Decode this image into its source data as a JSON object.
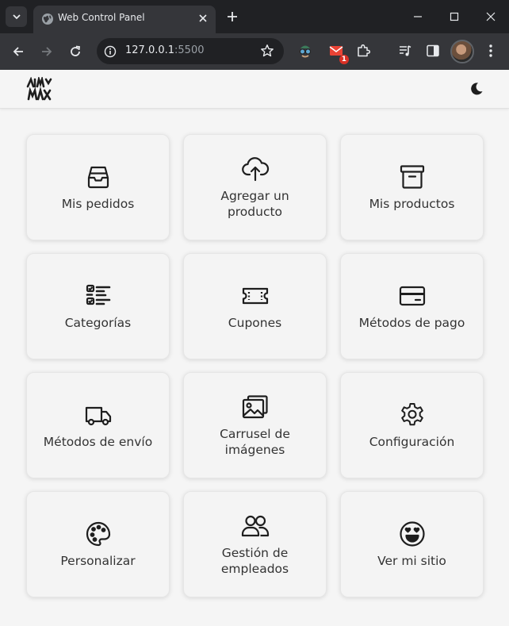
{
  "browser": {
    "tab_title": "Web Control Panel",
    "url_host": "127.0.0.1",
    "url_port": ":5500",
    "extension_badge": "1"
  },
  "colors": {
    "chrome_dark": "#202124",
    "chrome_toolbar": "#35363a",
    "page_bg": "#f5f5f5",
    "card_bg": "#f4f4f4",
    "text": "#333333"
  },
  "header": {
    "logo_icon": "brand-logo",
    "theme_icon": "moon-icon"
  },
  "cards": [
    {
      "label": "Mis pedidos",
      "icon": "inbox-tray-icon"
    },
    {
      "label": "Agregar un producto",
      "icon": "cloud-upload-icon"
    },
    {
      "label": "Mis productos",
      "icon": "archive-box-icon"
    },
    {
      "label": "Categorías",
      "icon": "checklist-icon"
    },
    {
      "label": "Cupones",
      "icon": "ticket-icon"
    },
    {
      "label": "Métodos de pago",
      "icon": "credit-card-icon"
    },
    {
      "label": "Métodos de envío",
      "icon": "truck-icon"
    },
    {
      "label": "Carrusel de imágenes",
      "icon": "photos-icon"
    },
    {
      "label": "Configuración",
      "icon": "gear-icon"
    },
    {
      "label": "Personalizar",
      "icon": "palette-icon"
    },
    {
      "label": "Gestión de empleados",
      "icon": "users-icon"
    },
    {
      "label": "Ver mi sitio",
      "icon": "smiley-heart-eyes-icon"
    }
  ]
}
